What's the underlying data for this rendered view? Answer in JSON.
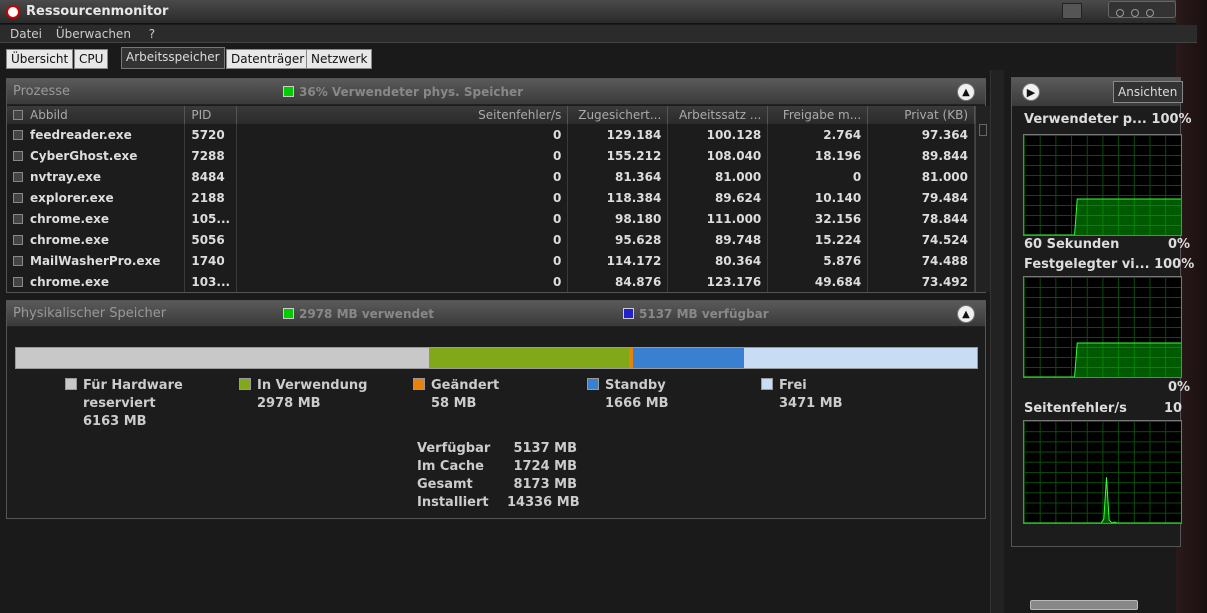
{
  "window": {
    "title": "Ressourcenmonitor"
  },
  "menu": [
    "Datei",
    "Überwachen",
    "?"
  ],
  "tabs": [
    "Übersicht",
    "CPU",
    "Arbeitsspeicher",
    "Datenträger",
    "Netzwerk"
  ],
  "processes": {
    "title": "Prozesse",
    "info": "36% Verwendeter phys. Speicher",
    "columns": [
      "Abbild",
      "PID",
      "Seitenfehler/s",
      "Zugesichert...",
      "Arbeitssatz ...",
      "Freigabe m...",
      "Privat (KB)"
    ],
    "rows": [
      [
        "feedreader.exe",
        "5720",
        "0",
        "129.184",
        "100.128",
        "2.764",
        "97.364"
      ],
      [
        "CyberGhost.exe",
        "7288",
        "0",
        "155.212",
        "108.040",
        "18.196",
        "89.844"
      ],
      [
        "nvtray.exe",
        "8484",
        "0",
        "81.364",
        "81.000",
        "0",
        "81.000"
      ],
      [
        "explorer.exe",
        "2188",
        "0",
        "118.384",
        "89.624",
        "10.140",
        "79.484"
      ],
      [
        "chrome.exe",
        "105...",
        "0",
        "98.180",
        "111.000",
        "32.156",
        "78.844"
      ],
      [
        "chrome.exe",
        "5056",
        "0",
        "95.628",
        "89.748",
        "15.224",
        "74.524"
      ],
      [
        "MailWasherPro.exe",
        "1740",
        "0",
        "114.172",
        "80.364",
        "5.876",
        "74.488"
      ],
      [
        "chrome.exe",
        "103...",
        "0",
        "84.876",
        "123.176",
        "49.684",
        "73.492"
      ]
    ]
  },
  "physical": {
    "title": "Physikalischer Speicher",
    "used_info": "2978 MB verwendet",
    "avail_info": "5137 MB verfügbar",
    "segments": [
      {
        "label": "Für Hardware reserviert",
        "value_mb": 6163,
        "color": "#c8c8c8"
      },
      {
        "label": "In Verwendung",
        "value_mb": 2978,
        "color": "#80a818"
      },
      {
        "label": "Geändert",
        "value_mb": 58,
        "color": "#e8820c"
      },
      {
        "label": "Standby",
        "value_mb": 1666,
        "color": "#3a80d0"
      },
      {
        "label": "Frei",
        "value_mb": 3471,
        "color": "#c8dcf4"
      }
    ],
    "legend": [
      {
        "line1": "Für Hardware",
        "line2": "reserviert",
        "line3": "6163 MB"
      },
      {
        "line1": "In Verwendung",
        "line2": "2978 MB"
      },
      {
        "line1": "Geändert",
        "line2": "58 MB"
      },
      {
        "line1": "Standby",
        "line2": "1666 MB"
      },
      {
        "line1": "Frei",
        "line2": "3471 MB"
      }
    ],
    "stats": [
      {
        "k": "Verfügbar",
        "v": "5137 MB"
      },
      {
        "k": "Im Cache",
        "v": "1724 MB"
      },
      {
        "k": "Gesamt",
        "v": "8173 MB"
      },
      {
        "k": "Installiert",
        "v": "14336 MB"
      }
    ]
  },
  "side": {
    "views_button": "Ansichten",
    "graphs": [
      {
        "label": "Verwendeter p...",
        "max": "100%",
        "foot_left": "60 Sekunden",
        "foot_right": "0%",
        "series": [
          0,
          0,
          0,
          0,
          0,
          0,
          0,
          0,
          0,
          0,
          0,
          0,
          0,
          0,
          0,
          0,
          0,
          0,
          0,
          0,
          36,
          36,
          36,
          36,
          36,
          36,
          36,
          36,
          36,
          36,
          36,
          36,
          36,
          36,
          36,
          36,
          36,
          36,
          36,
          36,
          36,
          36,
          36,
          36,
          36,
          36,
          36,
          36,
          36,
          36,
          36,
          36,
          36,
          36,
          36,
          36,
          36,
          36,
          36,
          36
        ]
      },
      {
        "label": "Festgelegter vi...",
        "max": "100%",
        "foot_left": "",
        "foot_right": "0%",
        "series": [
          0,
          0,
          0,
          0,
          0,
          0,
          0,
          0,
          0,
          0,
          0,
          0,
          0,
          0,
          0,
          0,
          0,
          0,
          0,
          0,
          34,
          34,
          34,
          34,
          34,
          34,
          34,
          34,
          34,
          34,
          34,
          34,
          34,
          34,
          34,
          34,
          34,
          34,
          34,
          34,
          34,
          34,
          34,
          34,
          34,
          34,
          34,
          34,
          34,
          34,
          34,
          34,
          34,
          34,
          34,
          34,
          34,
          34,
          34,
          34
        ]
      },
      {
        "label": "Seitenfehler/s",
        "max": "10",
        "foot_left": "",
        "foot_right": "",
        "series": [
          0,
          0,
          0,
          0,
          0,
          0,
          0,
          0,
          0,
          0,
          0,
          0,
          0,
          0,
          0,
          0,
          0,
          0,
          0,
          0,
          0,
          0,
          0,
          0,
          0,
          0,
          0,
          0,
          0,
          0,
          4,
          45,
          3,
          0,
          1,
          0,
          0,
          0,
          0,
          0,
          0,
          0,
          0,
          0,
          0,
          0,
          0,
          0,
          0,
          0,
          0,
          0,
          0,
          0,
          0,
          0,
          0,
          0,
          0,
          0
        ]
      }
    ]
  }
}
